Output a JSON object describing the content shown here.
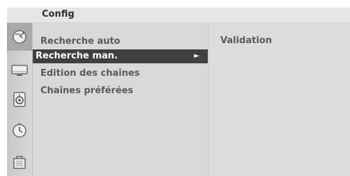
{
  "header": {
    "title": "Config"
  },
  "sidebar_icons": [
    {
      "name": "satellite-dish-icon",
      "active": true
    },
    {
      "name": "tv-screen-icon",
      "active": false
    },
    {
      "name": "speaker-icon",
      "active": false
    },
    {
      "name": "clock-icon",
      "active": false
    },
    {
      "name": "lock-options-icon",
      "active": false
    }
  ],
  "menu": {
    "items": [
      {
        "label": "Recherche auto"
      },
      {
        "label": "Recherche man.",
        "selected": true,
        "arrow": "►"
      },
      {
        "label": "Edition des chaînes"
      },
      {
        "label": "Chaînes préférées"
      }
    ]
  },
  "submenu": {
    "items": [
      {
        "label": "Validation"
      }
    ]
  },
  "colors": {
    "selection_bg": "#404040",
    "menu_bg": "#d9d9d9",
    "header_bg": "#e6e6e6",
    "text": "#5a5a5a"
  }
}
